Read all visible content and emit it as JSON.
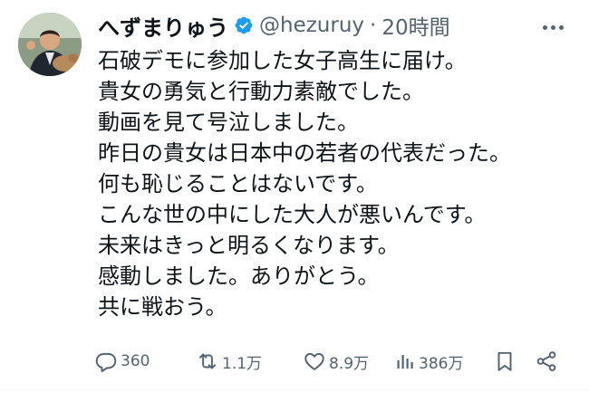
{
  "author": {
    "display_name": "へずまりゅう",
    "handle": "@hezuruy",
    "separator": "·",
    "timestamp": "20時間",
    "verified": true,
    "verified_color": "#1d9bf0"
  },
  "tweet": {
    "lines": [
      "石破デモに参加した女子高生に届け。",
      "貴女の勇気と行動力素敵でした。",
      "動画を見て号泣しました。",
      "昨日の貴女は日本中の若者の代表だった。",
      "何も恥じることはないです。",
      "こんな世の中にした大人が悪いんです。",
      "未来はきっと明るくなります。",
      "感動しました。ありがとう。",
      "共に戦おう。"
    ]
  },
  "actions": {
    "reply": {
      "icon": "reply-icon",
      "count": "360"
    },
    "retweet": {
      "icon": "retweet-icon",
      "count": "1.1万"
    },
    "like": {
      "icon": "heart-icon",
      "count": "8.9万"
    },
    "views": {
      "icon": "views-icon",
      "count": "386万"
    },
    "bookmark": {
      "icon": "bookmark-icon"
    },
    "share": {
      "icon": "share-icon"
    }
  },
  "colors": {
    "text": "#0f1419",
    "secondary": "#536471",
    "accent": "#1d9bf0"
  }
}
